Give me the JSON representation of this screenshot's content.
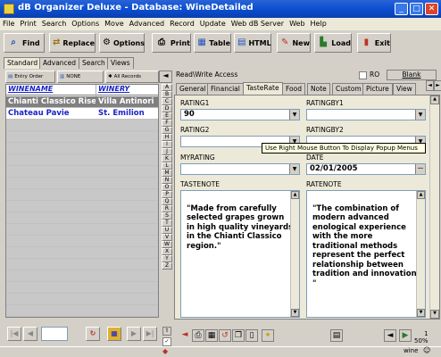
{
  "window": {
    "title": "dB Organizer Deluxe - Database: WineDetailed"
  },
  "menu": [
    "File",
    "Print",
    "Search",
    "Options",
    "Move",
    "Advanced",
    "Record",
    "Update",
    "Web dB Server",
    "Web",
    "Help"
  ],
  "toolbar": {
    "find": "Find",
    "replace": "Replace",
    "options": "Options",
    "print": "Print",
    "table": "Table",
    "html": "HTML",
    "new": "New",
    "load": "Load",
    "exit": "Exit"
  },
  "left_tabs": [
    "Standard",
    "Advanced",
    "Search",
    "Views"
  ],
  "sort_buttons": {
    "entry_order": "Entry Order",
    "none": "NONE",
    "all_records": "All Records"
  },
  "grid": {
    "columns": [
      "WINENAME",
      "WINERY"
    ],
    "rows": [
      [
        "Chianti Classico Riserva",
        "Villa Antinori"
      ],
      [
        "Chateau Pavie",
        "St. Emilion"
      ]
    ]
  },
  "alphabet": [
    "A",
    "B",
    "C",
    "D",
    "E",
    "F",
    "G",
    "H",
    "I",
    "J",
    "K",
    "L",
    "M",
    "N",
    "O",
    "P",
    "Q",
    "R",
    "S",
    "T",
    "U",
    "V",
    "W",
    "X",
    "Y",
    "Z"
  ],
  "record_panel": {
    "access": "Read\\Write Access",
    "ro_label": "RO",
    "blank_button": "Blank"
  },
  "tabs": [
    "General",
    "Financial",
    "TasteRate",
    "Food",
    "Note",
    "Custom",
    "Picture",
    "View"
  ],
  "active_tab": "TasteRate",
  "fields": {
    "rating1": {
      "label": "RATING1",
      "value": "90"
    },
    "ratingby1": {
      "label": "RATINGBY1",
      "value": ""
    },
    "rating2": {
      "label": "RATING2",
      "value": ""
    },
    "ratingby2": {
      "label": "RATINGBY2",
      "value": ""
    },
    "myrating": {
      "label": "MYRATING",
      "value": ""
    },
    "date": {
      "label": "DATE",
      "value": "02/01/2005"
    },
    "tastenote": {
      "label": "TASTENOTE",
      "value": "\"Made from carefully selected grapes grown in high quality vineyards in the Chianti Classico region.\""
    },
    "ratenote": {
      "label": "RATENOTE",
      "value": "\"The combination of modern advanced enological experience with the more traditional methods represent the perfect relationship between tradition and innovation. \""
    }
  },
  "tooltip": "Use Right Mouse Button To Display Popup Menus",
  "zoom": {
    "page": "1",
    "percent": "50%"
  },
  "status": {
    "user": "wine"
  },
  "colors": {
    "title_bar": "#0b4fd2",
    "header_text": "#1a23c8",
    "tooltip_bg": "#ffffe1"
  }
}
